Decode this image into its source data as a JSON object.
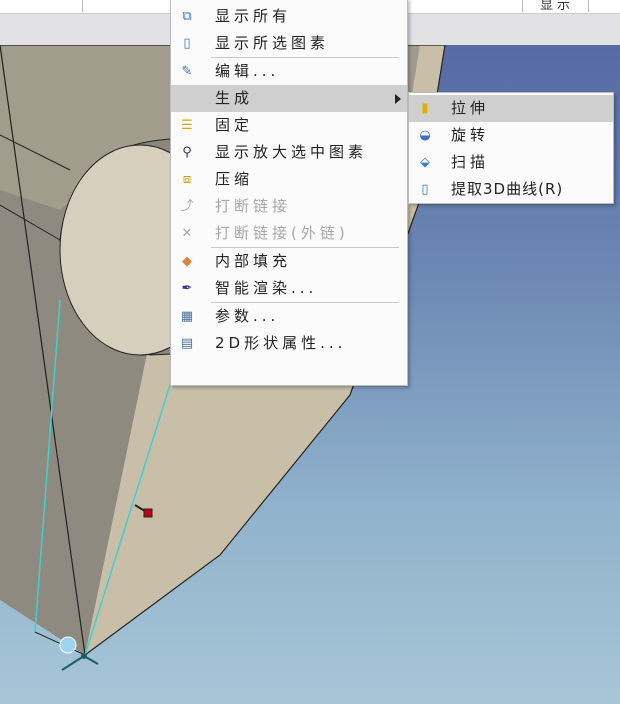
{
  "toolbar": {
    "display_label": "显示"
  },
  "context_menu": {
    "items": [
      {
        "label": "显示所有",
        "icon": "show-all-icon"
      },
      {
        "label": "显示所选图素",
        "icon": "show-selected-icon"
      },
      {
        "label": "编辑...",
        "icon": "edit-icon"
      },
      {
        "label": "生成",
        "icon": "none"
      },
      {
        "label": "固定",
        "icon": "fix-icon"
      },
      {
        "label": "显示放大选中图素",
        "icon": "zoom-icon"
      },
      {
        "label": "压缩",
        "icon": "compress-icon"
      },
      {
        "label": "打断链接",
        "icon": "break-link-icon",
        "disabled": true
      },
      {
        "label": "打断链接(外链)",
        "icon": "break-external-link-icon",
        "disabled": true
      },
      {
        "label": "内部填充",
        "icon": "fill-icon"
      },
      {
        "label": "智能渲染...",
        "icon": "render-icon"
      },
      {
        "label": "参数...",
        "icon": "parameters-icon"
      },
      {
        "label": "2D形状属性...",
        "icon": "shape-properties-icon"
      }
    ]
  },
  "submenu": {
    "items": [
      {
        "label": "拉伸",
        "icon": "extrude-icon"
      },
      {
        "label": "旋转",
        "icon": "revolve-icon"
      },
      {
        "label": "扫描",
        "icon": "sweep-icon"
      },
      {
        "label": "提取3D曲线(R)",
        "icon": "extract-curve-icon"
      }
    ]
  },
  "colors": {
    "highlight": "#cfcfcf",
    "shape": "#c8bea8",
    "edge": "#40d0d0"
  }
}
